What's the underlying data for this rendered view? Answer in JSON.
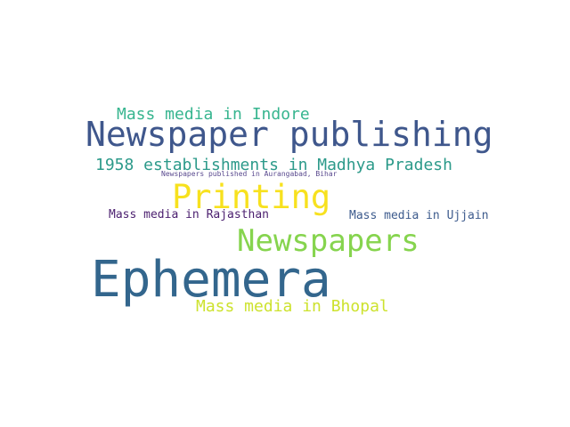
{
  "word_cloud": {
    "words": {
      "newspaper_publishing": {
        "text": "Newspaper publishing",
        "color": "#3f578c"
      },
      "ephemera": {
        "text": "Ephemera",
        "color": "#33668d"
      },
      "newspapers": {
        "text": "Newspapers",
        "color": "#86d44e"
      },
      "printing": {
        "text": "Printing",
        "color": "#f7e11e"
      },
      "indore": {
        "text": "Mass media in Indore",
        "color": "#37b58f"
      },
      "establishments_1958": {
        "text": "1958 establishments in Madhya Pradesh",
        "color": "#2c9a8a"
      },
      "aurangabad": {
        "text": "Newspapers published in Aurangabad, Bihar",
        "color": "#5a4a8f"
      },
      "rajasthan": {
        "text": "Mass media in Rajasthan",
        "color": "#4b1f6f"
      },
      "ujjain": {
        "text": "Mass media in Ujjain",
        "color": "#3d5b8d"
      },
      "bhopal": {
        "text": "Mass media in Bhopal",
        "color": "#cde22e"
      }
    }
  }
}
